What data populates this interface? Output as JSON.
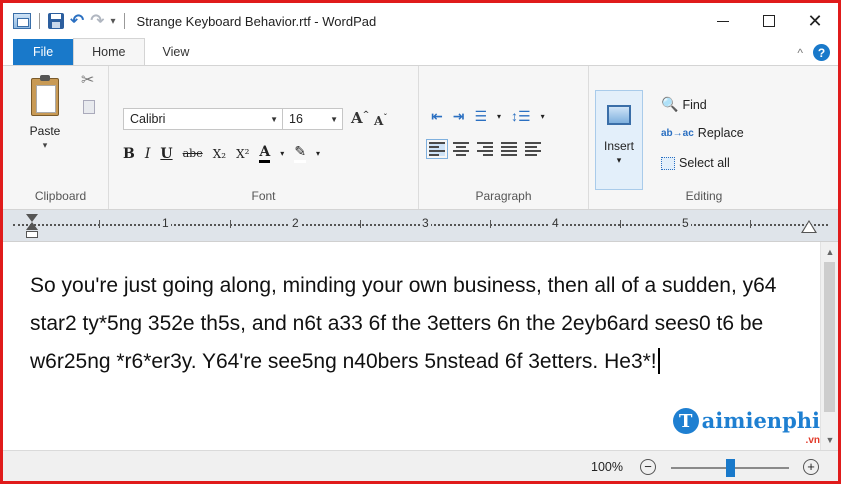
{
  "window": {
    "title": "Strange Keyboard Behavior.rtf - WordPad",
    "minimize_icon": "minimize-icon",
    "maximize_icon": "maximize-icon",
    "close_label": "✕"
  },
  "quick_access": {
    "icons": [
      "wordpad-app-icon",
      "save-icon",
      "undo-icon",
      "redo-icon",
      "customize-dropdown-icon"
    ],
    "redo_enabled": false
  },
  "tabs": [
    {
      "label": "File"
    },
    {
      "label": "Home",
      "active": true
    },
    {
      "label": "View"
    }
  ],
  "ribbon": {
    "clipboard": {
      "label": "Clipboard",
      "paste_label": "Paste"
    },
    "font": {
      "label": "Font",
      "family": "Calibri",
      "size": "16",
      "buttons": [
        "B",
        "I",
        "U",
        "abe",
        "X₂",
        "X²",
        "A"
      ]
    },
    "paragraph": {
      "label": "Paragraph",
      "active_alignment": "left"
    },
    "insert": {
      "label": "Insert"
    },
    "editing": {
      "label": "Editing",
      "find_label": "Find",
      "replace_label": "Replace",
      "select_all_label": "Select all"
    }
  },
  "ruler": {
    "numbers": [
      "1",
      "2",
      "3",
      "4",
      "5"
    ]
  },
  "document": {
    "text": "So you're just going along, minding your own business, then all of a sudden, y64 star2 ty*5ng 352e th5s, and n6t a33 6f the 3etters 6n the 2eyb6ard sees0 t6 be w6r25ng *r6*er3y. Y64're see5ng n40bers 5nstead 6f 3etters. He3*!"
  },
  "watermark": {
    "logo_letter": "T",
    "text": "aimienphi",
    "sub": ".vn"
  },
  "statusbar": {
    "zoom": "100%",
    "zoom_level": 0.5,
    "zoom_out_label": "−",
    "zoom_in_label": "+"
  },
  "colors": {
    "accent": "#1979ca",
    "frame_border": "#e01b1b",
    "ribbon_bg": "#f6f6f6",
    "ruler_bg": "#dfe4ea"
  }
}
